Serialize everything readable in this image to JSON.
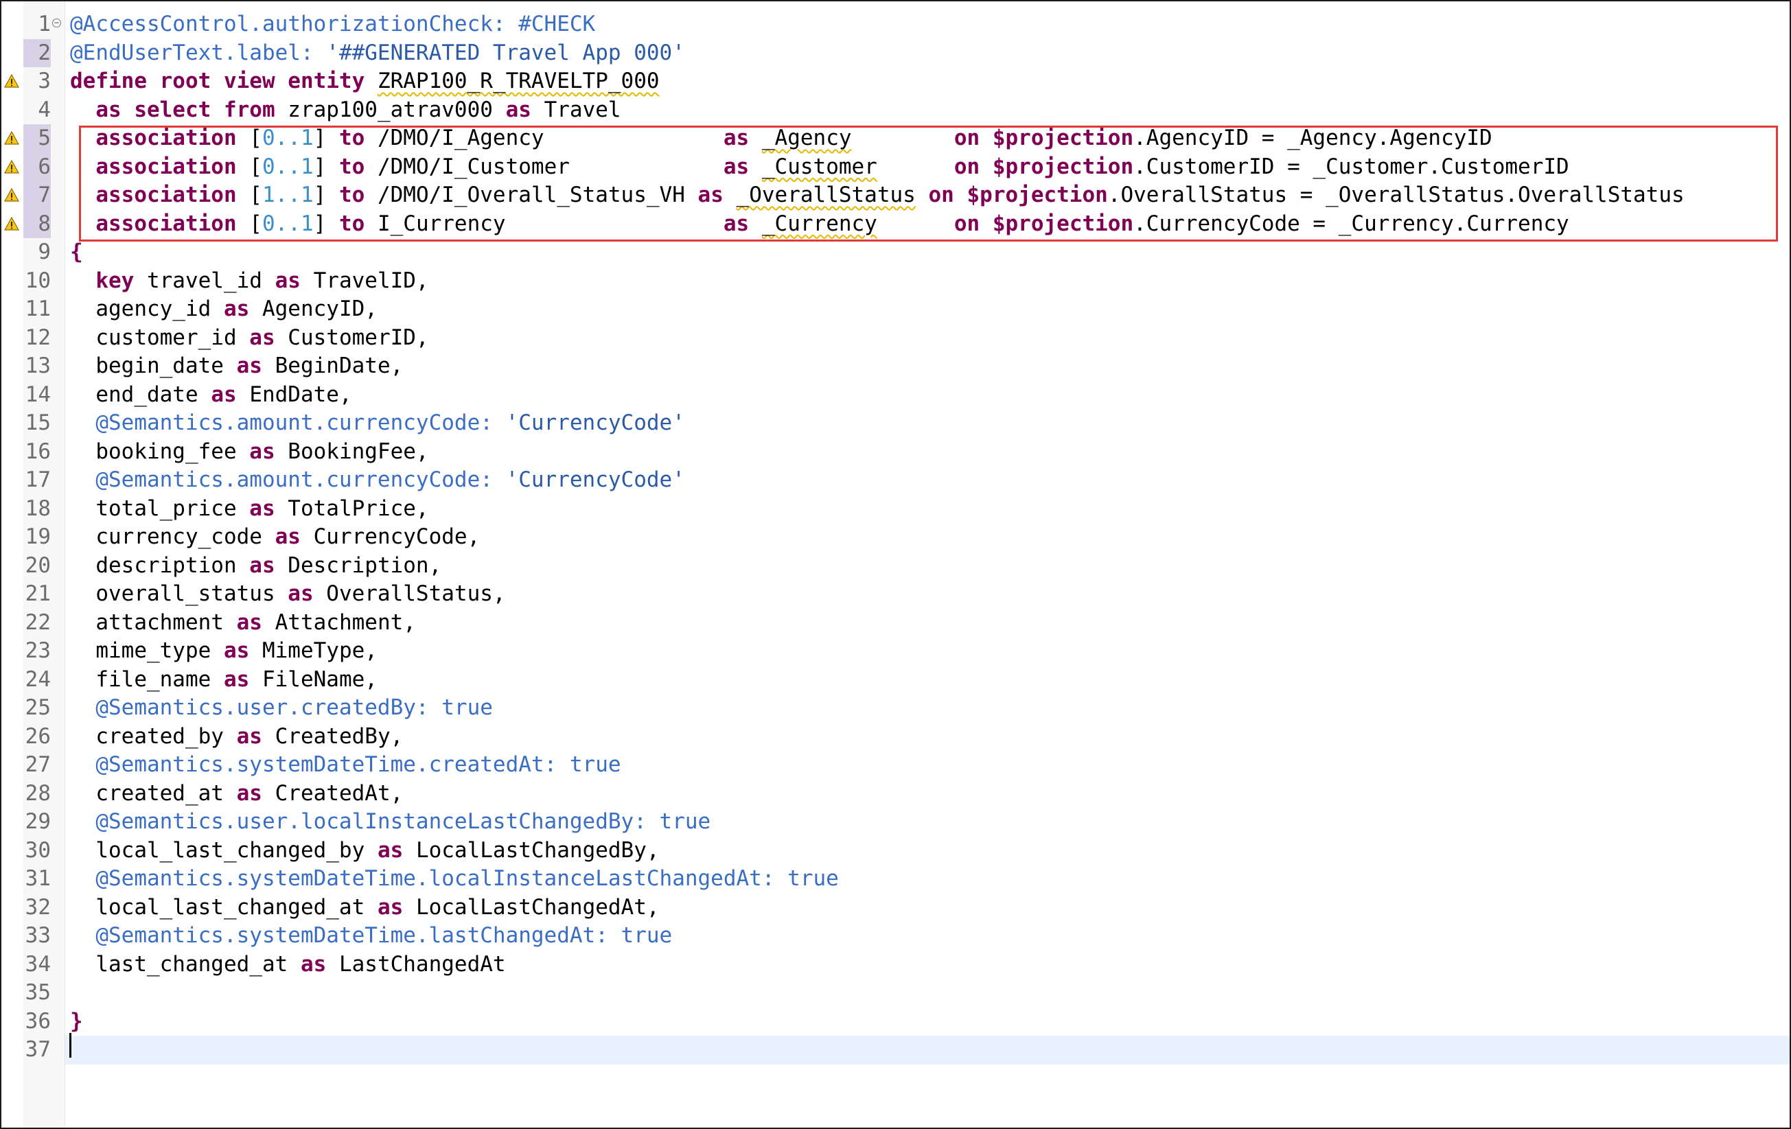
{
  "editor": {
    "language": "CDS",
    "warning_lines": [
      3,
      5,
      6,
      7,
      8
    ],
    "highlighted_range": "5-8",
    "current_line": 37,
    "lines": [
      {
        "n": "1",
        "segs": [
          [
            "ann",
            "@AccessControl.authorizationCheck: #CHECK"
          ]
        ]
      },
      {
        "n": "2",
        "segs": [
          [
            "ann",
            "@EndUserText.label: "
          ],
          [
            "str",
            "'##GENERATED Travel App 000'"
          ]
        ]
      },
      {
        "n": "3",
        "segs": [
          [
            "kw",
            "define root view entity "
          ],
          [
            "wavy",
            "ZRAP100_R_TRAVELTP_000"
          ]
        ]
      },
      {
        "n": "4",
        "segs": [
          [
            "",
            "  "
          ],
          [
            "kw",
            "as select from "
          ],
          [
            "",
            "zrap100_atrav000 "
          ],
          [
            "kw",
            "as "
          ],
          [
            "",
            "Travel"
          ]
        ]
      },
      {
        "n": "5",
        "segs": [
          [
            "",
            "  "
          ],
          [
            "kw",
            "association "
          ],
          [
            "",
            "["
          ],
          [
            "num",
            "0..1"
          ],
          [
            "",
            "] "
          ],
          [
            "kw",
            "to "
          ],
          [
            "",
            "/DMO/I_Agency              "
          ],
          [
            "kw",
            "as "
          ],
          [
            "wavy",
            "_Agency"
          ],
          [
            "",
            "        "
          ],
          [
            "kw",
            "on $projection"
          ],
          [
            "",
            ".AgencyID = _Agency.AgencyID"
          ]
        ]
      },
      {
        "n": "6",
        "segs": [
          [
            "",
            "  "
          ],
          [
            "kw",
            "association "
          ],
          [
            "",
            "["
          ],
          [
            "num",
            "0..1"
          ],
          [
            "",
            "] "
          ],
          [
            "kw",
            "to "
          ],
          [
            "",
            "/DMO/I_Customer            "
          ],
          [
            "kw",
            "as "
          ],
          [
            "wavy",
            "_Customer"
          ],
          [
            "",
            "      "
          ],
          [
            "kw",
            "on $projection"
          ],
          [
            "",
            ".CustomerID = _Customer.CustomerID"
          ]
        ]
      },
      {
        "n": "7",
        "segs": [
          [
            "",
            "  "
          ],
          [
            "kw",
            "association "
          ],
          [
            "",
            "["
          ],
          [
            "num",
            "1..1"
          ],
          [
            "",
            "] "
          ],
          [
            "kw",
            "to "
          ],
          [
            "",
            "/DMO/I_Overall_Status_VH "
          ],
          [
            "kw",
            "as "
          ],
          [
            "wavy",
            "_OverallStatus"
          ],
          [
            "",
            ""
          ],
          [
            "kw",
            " on $projection"
          ],
          [
            "",
            ".OverallStatus = _OverallStatus.OverallStatus"
          ]
        ]
      },
      {
        "n": "8",
        "segs": [
          [
            "",
            "  "
          ],
          [
            "kw",
            "association "
          ],
          [
            "",
            "["
          ],
          [
            "num",
            "0..1"
          ],
          [
            "",
            "] "
          ],
          [
            "kw",
            "to "
          ],
          [
            "",
            "I_Currency                 "
          ],
          [
            "kw",
            "as "
          ],
          [
            "wavy",
            "_Currency"
          ],
          [
            "",
            "      "
          ],
          [
            "kw",
            "on $projection"
          ],
          [
            "",
            ".CurrencyCode = _Currency.Currency"
          ]
        ]
      },
      {
        "n": "9",
        "segs": [
          [
            "kw",
            "{"
          ]
        ]
      },
      {
        "n": "10",
        "segs": [
          [
            "",
            "  "
          ],
          [
            "kw",
            "key "
          ],
          [
            "",
            "travel_id "
          ],
          [
            "kw",
            "as "
          ],
          [
            "",
            "TravelID,"
          ]
        ]
      },
      {
        "n": "11",
        "segs": [
          [
            "",
            "  agency_id "
          ],
          [
            "kw",
            "as "
          ],
          [
            "",
            "AgencyID,"
          ]
        ]
      },
      {
        "n": "12",
        "segs": [
          [
            "",
            "  customer_id "
          ],
          [
            "kw",
            "as "
          ],
          [
            "",
            "CustomerID,"
          ]
        ]
      },
      {
        "n": "13",
        "segs": [
          [
            "",
            "  begin_date "
          ],
          [
            "kw",
            "as "
          ],
          [
            "",
            "BeginDate,"
          ]
        ]
      },
      {
        "n": "14",
        "segs": [
          [
            "",
            "  end_date "
          ],
          [
            "kw",
            "as "
          ],
          [
            "",
            "EndDate,"
          ]
        ]
      },
      {
        "n": "15",
        "segs": [
          [
            "",
            "  "
          ],
          [
            "ann",
            "@Semantics.amount.currencyCode: "
          ],
          [
            "str",
            "'CurrencyCode'"
          ]
        ]
      },
      {
        "n": "16",
        "segs": [
          [
            "",
            "  booking_fee "
          ],
          [
            "kw",
            "as "
          ],
          [
            "",
            "BookingFee,"
          ]
        ]
      },
      {
        "n": "17",
        "segs": [
          [
            "",
            "  "
          ],
          [
            "ann",
            "@Semantics.amount.currencyCode: "
          ],
          [
            "str",
            "'CurrencyCode'"
          ]
        ]
      },
      {
        "n": "18",
        "segs": [
          [
            "",
            "  total_price "
          ],
          [
            "kw",
            "as "
          ],
          [
            "",
            "TotalPrice,"
          ]
        ]
      },
      {
        "n": "19",
        "segs": [
          [
            "",
            "  currency_code "
          ],
          [
            "kw",
            "as "
          ],
          [
            "",
            "CurrencyCode,"
          ]
        ]
      },
      {
        "n": "20",
        "segs": [
          [
            "",
            "  description "
          ],
          [
            "kw",
            "as "
          ],
          [
            "",
            "Description,"
          ]
        ]
      },
      {
        "n": "21",
        "segs": [
          [
            "",
            "  overall_status "
          ],
          [
            "kw",
            "as "
          ],
          [
            "",
            "OverallStatus,"
          ]
        ]
      },
      {
        "n": "22",
        "segs": [
          [
            "",
            "  attachment "
          ],
          [
            "kw",
            "as "
          ],
          [
            "",
            "Attachment,"
          ]
        ]
      },
      {
        "n": "23",
        "segs": [
          [
            "",
            "  mime_type "
          ],
          [
            "kw",
            "as "
          ],
          [
            "",
            "MimeType,"
          ]
        ]
      },
      {
        "n": "24",
        "segs": [
          [
            "",
            "  file_name "
          ],
          [
            "kw",
            "as "
          ],
          [
            "",
            "FileName,"
          ]
        ]
      },
      {
        "n": "25",
        "segs": [
          [
            "",
            "  "
          ],
          [
            "ann",
            "@Semantics.user.createdBy: true"
          ]
        ]
      },
      {
        "n": "26",
        "segs": [
          [
            "",
            "  created_by "
          ],
          [
            "kw",
            "as "
          ],
          [
            "",
            "CreatedBy,"
          ]
        ]
      },
      {
        "n": "27",
        "segs": [
          [
            "",
            "  "
          ],
          [
            "ann",
            "@Semantics.systemDateTime.createdAt: true"
          ]
        ]
      },
      {
        "n": "28",
        "segs": [
          [
            "",
            "  created_at "
          ],
          [
            "kw",
            "as "
          ],
          [
            "",
            "CreatedAt,"
          ]
        ]
      },
      {
        "n": "29",
        "segs": [
          [
            "",
            "  "
          ],
          [
            "ann",
            "@Semantics.user.localInstanceLastChangedBy: true"
          ]
        ]
      },
      {
        "n": "30",
        "segs": [
          [
            "",
            "  local_last_changed_by "
          ],
          [
            "kw",
            "as "
          ],
          [
            "",
            "LocalLastChangedBy,"
          ]
        ]
      },
      {
        "n": "31",
        "segs": [
          [
            "",
            "  "
          ],
          [
            "ann",
            "@Semantics.systemDateTime.localInstanceLastChangedAt: true"
          ]
        ]
      },
      {
        "n": "32",
        "segs": [
          [
            "",
            "  local_last_changed_at "
          ],
          [
            "kw",
            "as "
          ],
          [
            "",
            "LocalLastChangedAt,"
          ]
        ]
      },
      {
        "n": "33",
        "segs": [
          [
            "",
            "  "
          ],
          [
            "ann",
            "@Semantics.systemDateTime.lastChangedAt: true"
          ]
        ]
      },
      {
        "n": "34",
        "segs": [
          [
            "",
            "  last_changed_at "
          ],
          [
            "kw",
            "as "
          ],
          [
            "",
            "LastChangedAt"
          ]
        ]
      },
      {
        "n": "35",
        "segs": []
      },
      {
        "n": "36",
        "segs": [
          [
            "kw",
            "}"
          ]
        ]
      },
      {
        "n": "37",
        "segs": []
      }
    ]
  },
  "colors": {
    "keyword": "#7f0055",
    "annotation": "#3a6dc4",
    "highlight_box": "#e03a3a",
    "current_line": "#e8f2fe"
  }
}
